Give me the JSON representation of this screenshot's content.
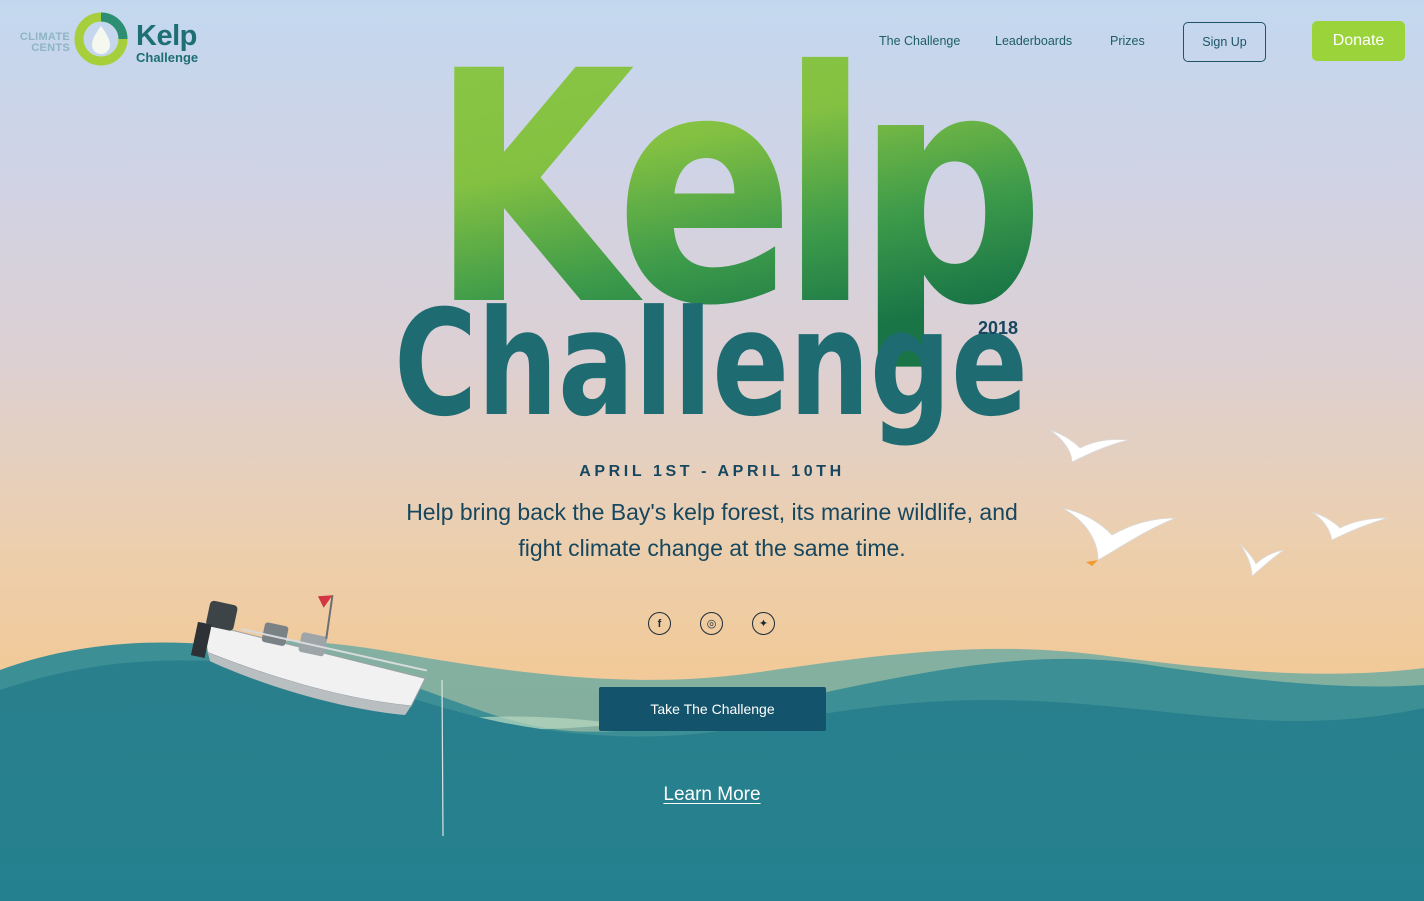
{
  "header": {
    "logo": {
      "climate_cents": "CLIMATE CENTS",
      "kelp": "Kelp",
      "challenge": "Challenge"
    },
    "nav": [
      {
        "label": "The Challenge"
      },
      {
        "label": "Leaderboards"
      },
      {
        "label": "Prizes"
      }
    ],
    "signup_label": "Sign Up",
    "donate_label": "Donate"
  },
  "hero": {
    "title_top": "Kelp",
    "title_bottom": "Challenge",
    "year": "2018",
    "dates": "APRIL 1ST - APRIL 10TH",
    "tagline_line1": "Help bring back the Bay's kelp forest, its marine wildlife, and",
    "tagline_line2": "fight climate change at the same time.",
    "social": [
      {
        "icon": "facebook-icon",
        "glyph": "f"
      },
      {
        "icon": "instagram-icon",
        "glyph": "◎"
      },
      {
        "icon": "twitter-icon",
        "glyph": "✦"
      }
    ],
    "cta_label": "Take The Challenge",
    "learn_more_label": "Learn More"
  },
  "colors": {
    "kelp_green": "#8cc63f",
    "kelp_dark_green": "#1d7f4a",
    "challenge_teal": "#1e6b72",
    "navy": "#17475f",
    "donate": "#9bd33a",
    "ocean": "#267f8b"
  }
}
